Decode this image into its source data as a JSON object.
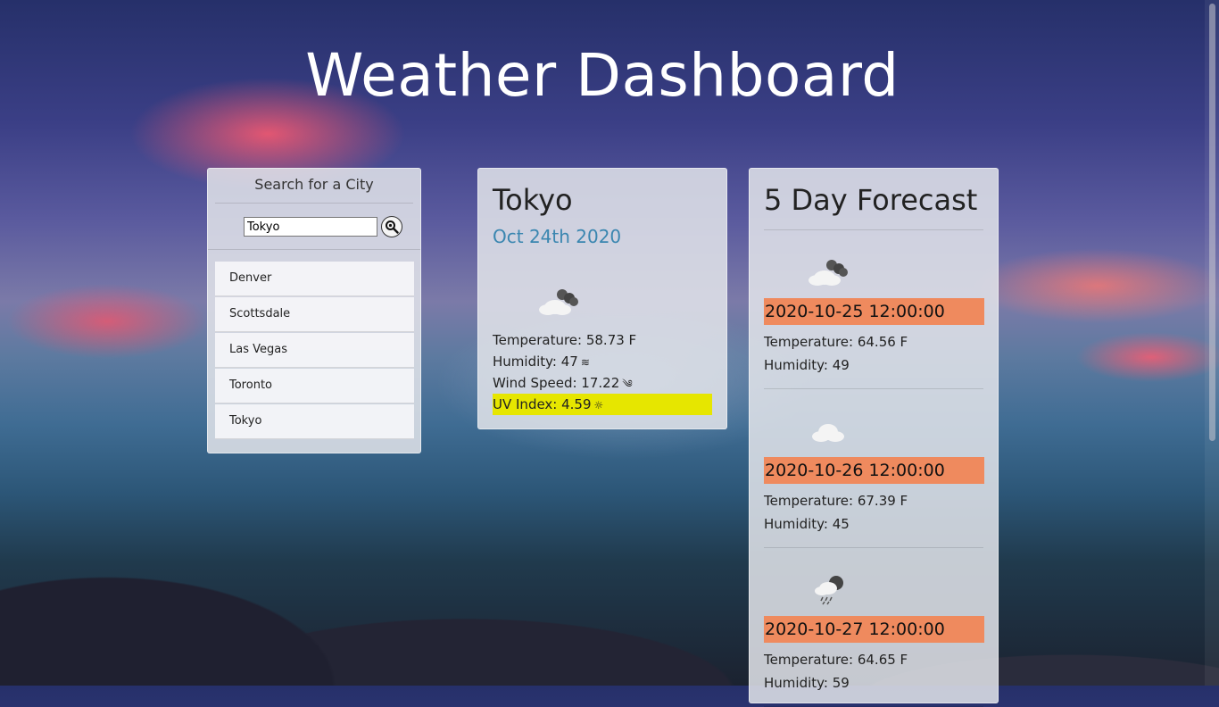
{
  "page": {
    "title": "Weather Dashboard"
  },
  "search": {
    "heading": "Search for a City",
    "input_value": "Tokyo",
    "button_icon": "search-icon",
    "history": [
      "Denver",
      "Scottsdale",
      "Las Vegas",
      "Toronto",
      "Tokyo"
    ]
  },
  "current": {
    "city": "Tokyo",
    "date": "Oct 24th 2020",
    "icon": "partly-cloudy-night-icon",
    "temperature": "Temperature: 58.73 F",
    "humidity": "Humidity: 47",
    "humidity_icon": "≋",
    "wind": "Wind Speed: 17.22",
    "wind_icon": "༄",
    "uv": "UV Index: 4.59",
    "uv_icon": "☼",
    "uv_color": "#e6e600"
  },
  "forecast": {
    "title": "5 Day Forecast",
    "date_bg_color": "#ef8a5e",
    "days": [
      {
        "date": "2020-10-25 12:00:00",
        "temperature": "Temperature: 64.56 F",
        "humidity": "Humidity: 49",
        "icon": "partly-cloudy-night-icon"
      },
      {
        "date": "2020-10-26 12:00:00",
        "temperature": "Temperature: 67.39 F",
        "humidity": "Humidity: 45",
        "icon": "cloud-icon"
      },
      {
        "date": "2020-10-27 12:00:00",
        "temperature": "Temperature: 64.65 F",
        "humidity": "Humidity: 59",
        "icon": "rain-night-icon"
      }
    ]
  }
}
